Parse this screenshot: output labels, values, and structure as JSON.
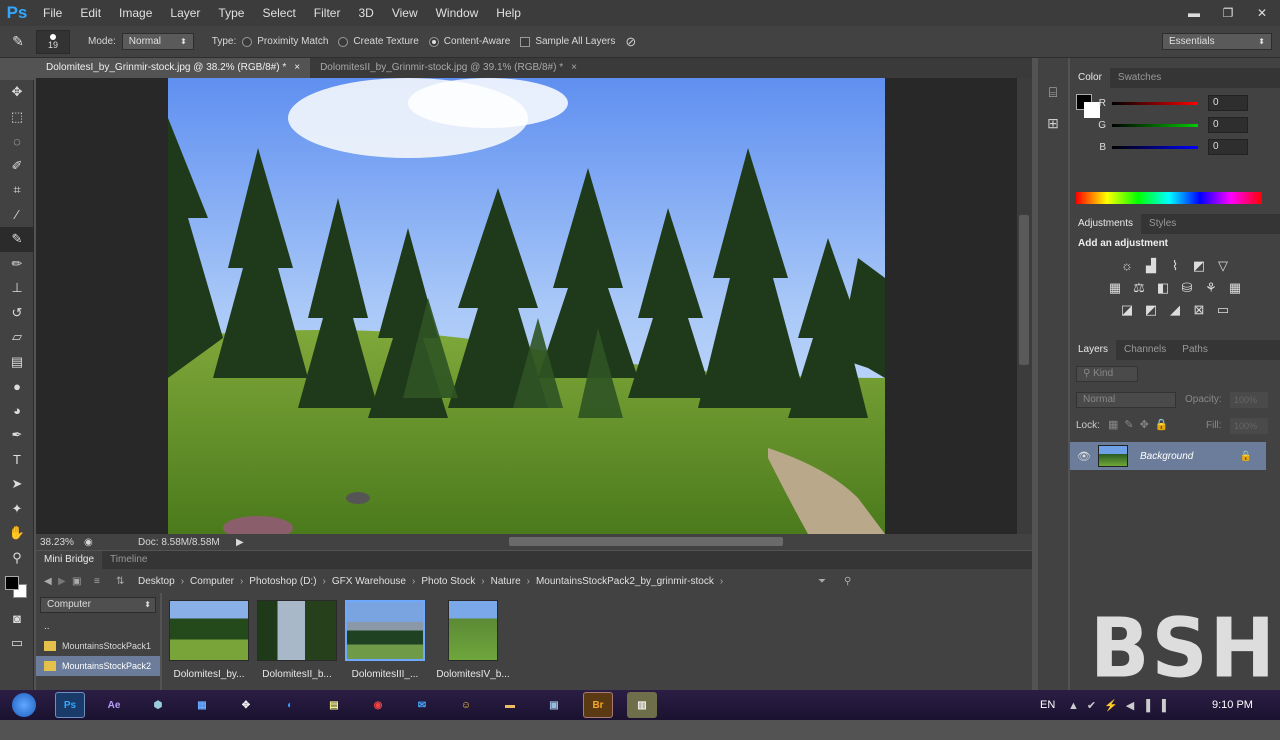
{
  "app": {
    "logo": "Ps"
  },
  "menu": [
    "File",
    "Edit",
    "Image",
    "Layer",
    "Type",
    "Select",
    "Filter",
    "3D",
    "View",
    "Window",
    "Help"
  ],
  "window_controls": {
    "minimize": "▬",
    "restore": "❐",
    "close": "✕"
  },
  "options": {
    "brush_size": "19",
    "mode_label": "Mode:",
    "mode_value": "Normal",
    "type_label": "Type:",
    "proximity_match": "Proximity Match",
    "create_texture": "Create Texture",
    "content_aware": "Content-Aware",
    "selected_type": "Content-Aware",
    "sample_all_layers": "Sample All Layers",
    "sample_all_checked": false,
    "workspace": "Essentials"
  },
  "tabs": [
    {
      "label": "DolomitesI_by_Grinmir-stock.jpg @ 38.2% (RGB/8#) *",
      "active": true
    },
    {
      "label": "DolomitesII_by_Grinmir-stock.jpg @ 39.1% (RGB/8#) *",
      "active": false
    }
  ],
  "status": {
    "zoom": "38.23%",
    "doc": "Doc: 8.58M/8.58M"
  },
  "color_panel": {
    "tabs": [
      "Color",
      "Swatches"
    ],
    "channels": [
      {
        "label": "R",
        "value": "0",
        "color": "#ff0000"
      },
      {
        "label": "G",
        "value": "0",
        "color": "#00c000"
      },
      {
        "label": "B",
        "value": "0",
        "color": "#0000ff"
      }
    ]
  },
  "adjustments": {
    "tabs": [
      "Adjustments",
      "Styles"
    ],
    "title": "Add an adjustment"
  },
  "layers": {
    "tabs": [
      "Layers",
      "Channels",
      "Paths"
    ],
    "kind": "Kind",
    "blend_mode": "Normal",
    "opacity_label": "Opacity:",
    "opacity": "100%",
    "lock_label": "Lock:",
    "fill_label": "Fill:",
    "fill": "100%",
    "layer_name": "Background"
  },
  "mini_bridge": {
    "tabs": [
      "Mini Bridge",
      "Timeline"
    ],
    "breadcrumbs": [
      "Desktop",
      "Computer",
      "Photoshop (D:)",
      "GFX Warehouse",
      "Photo Stock",
      "Nature",
      "MountainsStockPack2_by_grinmir-stock"
    ],
    "location": "Computer",
    "up_item": "..",
    "folders": [
      "MountainsStockPack1",
      "MountainsStockPack2"
    ],
    "selected_folder": "MountainsStockPack2",
    "thumbnails": [
      "DolomitesI_by...",
      "DolomitesII_b...",
      "DolomitesIII_...",
      "DolomitesIV_b..."
    ],
    "selected_thumbnail": 2
  },
  "taskbar": {
    "lang": "EN",
    "time": "9:10 PM",
    "apps": [
      "Ps",
      "Ae",
      "Br"
    ]
  },
  "watermark": "BSHD"
}
